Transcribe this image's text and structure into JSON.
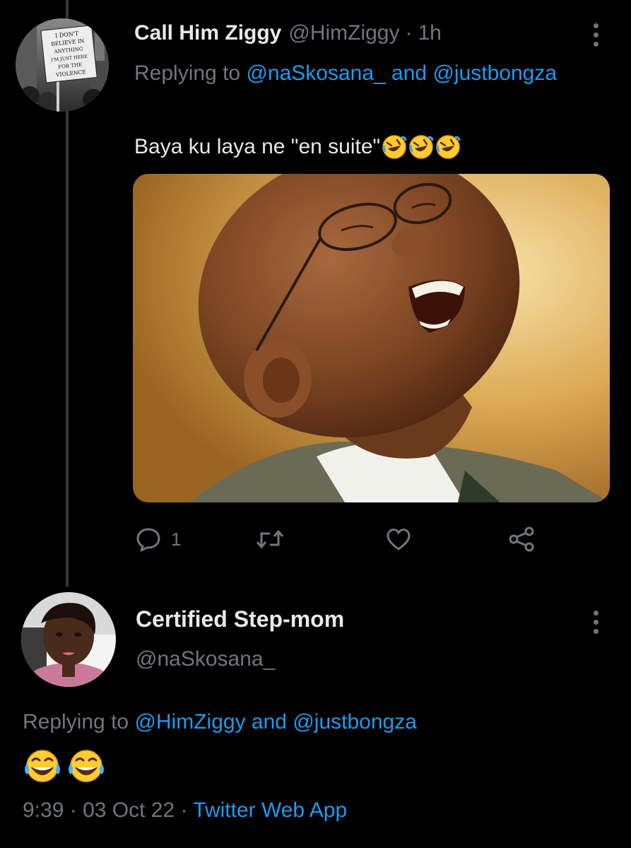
{
  "tweet1": {
    "name": "Call Him Ziggy",
    "handle": "@HimZiggy",
    "separator": "·",
    "time": "1h",
    "replying_prefix": "Replying to",
    "mention_1": "@naSkosana_",
    "conjunction": "and",
    "mention_2": "@justbongza",
    "text": "Baya ku laya ne \"en suite\"",
    "emojis": [
      "rolling-on-floor-laughing",
      "rolling-on-floor-laughing",
      "rolling-on-floor-laughing"
    ],
    "avatar_sign": [
      "I DON'T",
      "BELIEVE IN",
      "ANYTHING",
      "I'M JUST HERE",
      "FOR THE",
      "VIOLENCE"
    ],
    "actions": {
      "reply_count": "1"
    },
    "colors": {
      "image_bg_light": "#f3dca0",
      "image_bg_dark": "#b07a2c"
    }
  },
  "tweet2": {
    "name": "Certified Step-mom",
    "handle": "@naSkosana_",
    "replying_prefix": "Replying to",
    "mention_1": "@HimZiggy",
    "conjunction": "and",
    "mention_2": "@justbongza",
    "emojis": [
      "face-with-tears-of-joy",
      "face-with-tears-of-joy"
    ],
    "time": "9:39",
    "separator": "·",
    "date": "03 Oct 22",
    "source": "Twitter Web App"
  },
  "colors": {
    "background": "#000000",
    "primary_text": "#e7e9ea",
    "secondary_text": "#71767b",
    "accent": "#1d9bf0",
    "thread_line": "#333639"
  }
}
